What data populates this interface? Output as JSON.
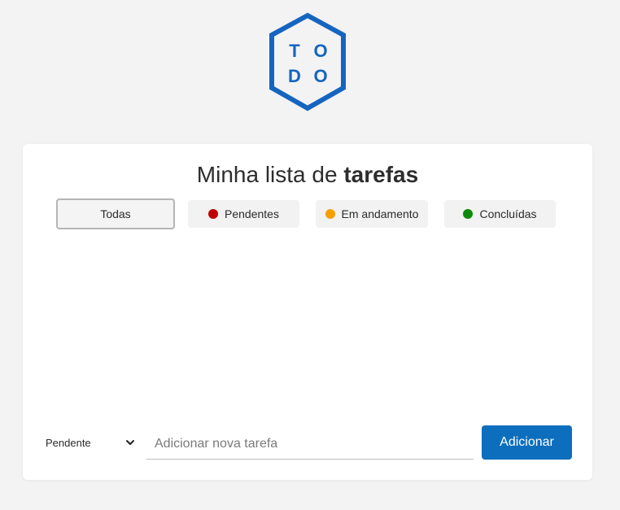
{
  "logo": {
    "letters": [
      "T",
      "O",
      "D",
      "O"
    ],
    "color": "#1565c0"
  },
  "header": {
    "title_regular": "Minha lista de ",
    "title_bold": "tarefas"
  },
  "filters": [
    {
      "label": "Todas",
      "active": true,
      "dot_color": null
    },
    {
      "label": "Pendentes",
      "active": false,
      "dot_color": "#c00000"
    },
    {
      "label": "Em andamento",
      "active": false,
      "dot_color": "#f5a000"
    },
    {
      "label": "Concluídas",
      "active": false,
      "dot_color": "#0a8a0a"
    }
  ],
  "tasks": [],
  "new_task": {
    "status_selected": "Pendente",
    "placeholder": "Adicionar nova tarefa",
    "value": "",
    "add_label": "Adicionar"
  },
  "colors": {
    "background": "#f3f3f3",
    "card": "#ffffff",
    "accent": "#0d6ebd"
  }
}
